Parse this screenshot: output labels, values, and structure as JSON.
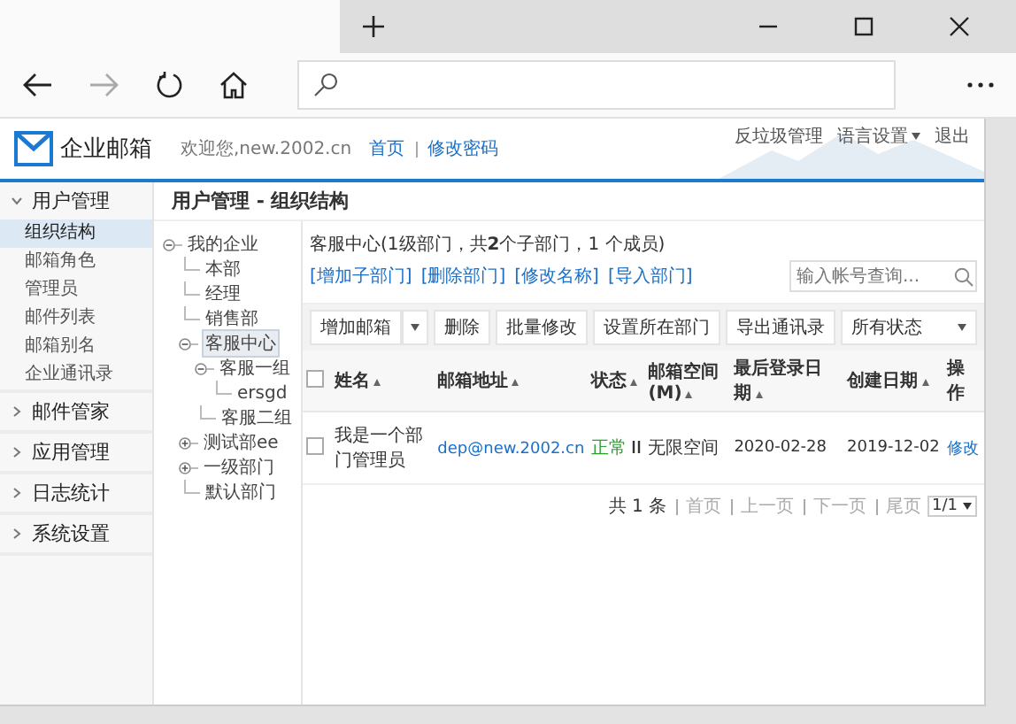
{
  "header": {
    "logo": "企业邮箱",
    "welcome": "欢迎您,new.2002.cn",
    "links": [
      "首页",
      "修改密码"
    ],
    "top_links": [
      {
        "label": "反垃圾管理",
        "menu": false
      },
      {
        "label": "语言设置",
        "menu": true
      },
      {
        "label": "退出",
        "menu": false
      }
    ]
  },
  "sidebar": [
    {
      "label": "用户管理",
      "expanded": true,
      "items": [
        {
          "label": "组织结构",
          "selected": true
        },
        {
          "label": "邮箱角色",
          "selected": false
        },
        {
          "label": "管理员",
          "selected": false
        },
        {
          "label": "邮件列表",
          "selected": false
        },
        {
          "label": "邮箱别名",
          "selected": false
        },
        {
          "label": "企业通讯录",
          "selected": false
        }
      ]
    },
    {
      "label": "邮件管家",
      "expanded": false
    },
    {
      "label": "应用管理",
      "expanded": false
    },
    {
      "label": "日志统计",
      "expanded": false
    },
    {
      "label": "系统设置",
      "expanded": false
    }
  ],
  "breadcrumb": "用户管理 - 组织结构",
  "tree": [
    {
      "label": "我的企业",
      "expanded": true,
      "selected": false,
      "children": [
        {
          "label": "本部",
          "selected": false
        },
        {
          "label": "经理",
          "selected": false
        },
        {
          "label": "销售部",
          "selected": false
        },
        {
          "label": "客服中心",
          "expanded": true,
          "selected": true,
          "children": [
            {
              "label": "客服一组",
              "expanded": true,
              "selected": false,
              "children": [
                {
                  "label": "ersgd",
                  "selected": false
                }
              ]
            },
            {
              "label": "客服二组",
              "selected": false
            }
          ]
        },
        {
          "label": "测试部ee",
          "expanded": false,
          "selected": false
        },
        {
          "label": "一级部门",
          "expanded": false,
          "selected": false
        },
        {
          "label": "默认部门",
          "selected": false
        }
      ]
    }
  ],
  "dept_info": "客服中心(1级部门，共**2**个子部门，1 个成员)",
  "dept_links": [
    "[增加子部门]",
    "[删除部门]",
    "[修改名称]",
    "[导入部门]"
  ],
  "search": {
    "placeholder": "输入帐号查询..."
  },
  "toolbar": [
    {
      "kind": "split",
      "label": "增加邮箱"
    },
    {
      "kind": "button",
      "label": "删除"
    },
    {
      "kind": "button",
      "label": "批量修改"
    },
    {
      "kind": "button",
      "label": "设置所在部门"
    },
    {
      "kind": "button",
      "label": "导出通讯录"
    },
    {
      "kind": "select",
      "label": "所有状态"
    }
  ],
  "table": {
    "all_checked": false,
    "columns": [
      {
        "label": "姓名",
        "sortable": true
      },
      {
        "label": "邮箱地址",
        "sortable": true
      },
      {
        "label": "状态",
        "sortable": true
      },
      {
        "label": "邮箱空间(M)",
        "sortable": true
      },
      {
        "label": "最后登录日期",
        "sortable": true
      },
      {
        "label": "创建日期",
        "sortable": true
      },
      {
        "label": "操作",
        "sortable": false
      }
    ],
    "rows": [
      {
        "checked": false,
        "name": "我是一个部门管理员",
        "email": "dep@new.2002.cn",
        "status": {
          "text": "正常",
          "kind": "normal"
        },
        "space": "无限空间",
        "last_login": "2020-02-28",
        "created": "2019-12-02",
        "action": "修改"
      }
    ]
  },
  "pagination": {
    "total": "共 1 条",
    "links": [
      {
        "label": "首页",
        "disabled": true
      },
      {
        "label": "上一页",
        "disabled": true
      },
      {
        "label": "下一页",
        "disabled": true
      },
      {
        "label": "尾页",
        "disabled": true
      }
    ],
    "page": "1/1"
  }
}
